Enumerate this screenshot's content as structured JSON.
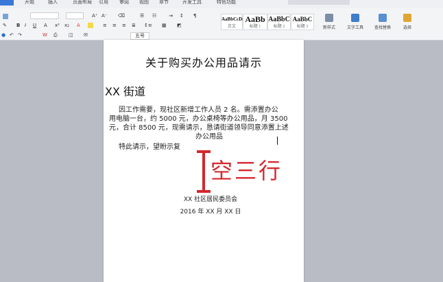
{
  "ribbon": {
    "tabs": [
      "开始",
      "插入",
      "页面布局",
      "引用",
      "审阅",
      "视图",
      "章节",
      "开发工具",
      "特色功能"
    ],
    "styles": [
      {
        "sample": "AaBbCcDd",
        "caption": "正文"
      },
      {
        "sample": "AaBb",
        "caption": "标题 1"
      },
      {
        "sample": "AaBbC",
        "caption": "标题 2"
      },
      {
        "sample": "AaBbC",
        "caption": "标题 3"
      }
    ],
    "tools": [
      "新样式",
      "文字工具",
      "查找替换",
      "选择"
    ],
    "font_size_box": "五号"
  },
  "document": {
    "title": "关于购买办公用品请示",
    "addressee": "XX 街道",
    "body_line1": "因工作需要，现社区新增工作人员 2 名。需添置办公",
    "body_line2": "用电脑一台，约 5000 元，办公桌椅等办公用品，月 3500",
    "body_line3": "元，合计 8500 元，现需请示，恳请街道领导同意添置上述",
    "body_line4": "办公用品",
    "request": "特此请示，望盼示复",
    "org": "XX 社区居民委员会",
    "date": "2016 年 XX 月 XX 日"
  },
  "annotation": {
    "text": "空三行",
    "color": "#d4262c"
  }
}
